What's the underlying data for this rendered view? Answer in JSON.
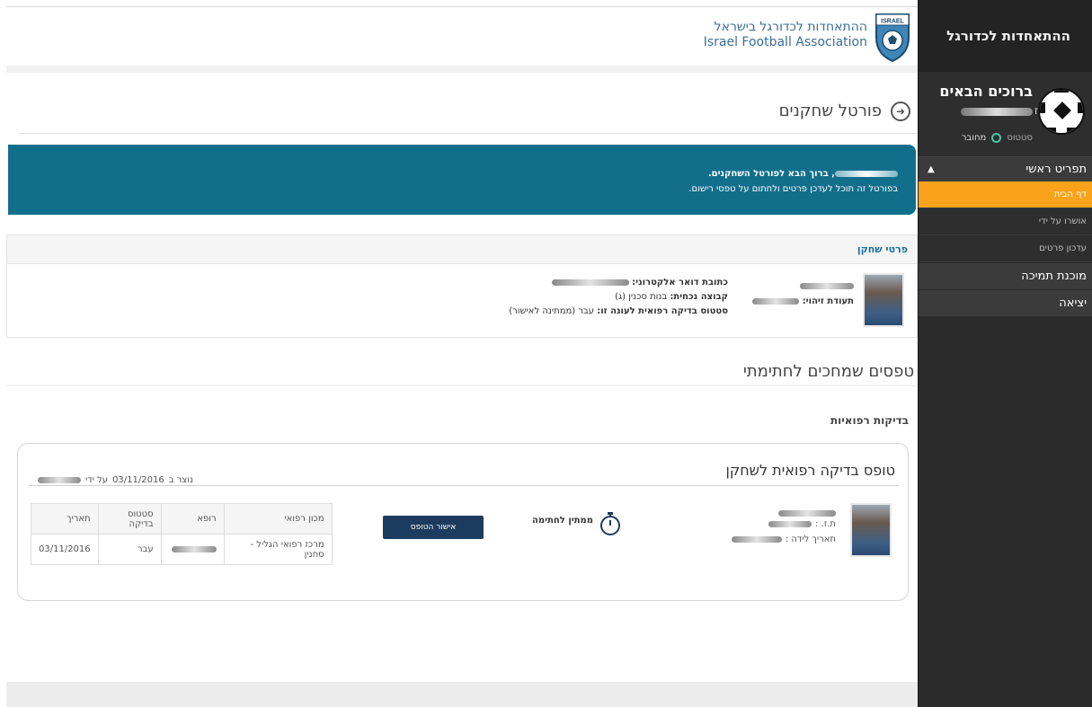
{
  "sidebar": {
    "brand": "ההתאחדות לכדורגל",
    "user_greeting": "ברוכים הבאים",
    "user_id_suffix": "ז",
    "status_label": "סטטוס",
    "status_value": "מחובר",
    "status_color": "#4bc6a4",
    "main_menu_label": "תפריט ראשי",
    "main_menu_icon": "triangle-up-icon",
    "sub_items": [
      {
        "label": "דף הבית",
        "active": true
      },
      {
        "label": "אושרו על ידי"
      },
      {
        "label": "עדכון פרטים"
      }
    ],
    "support_label": "מוכנת תמיכה",
    "logout_label": "יציאה"
  },
  "header": {
    "org_he": "ההתאחדות לכדורגל בישראל",
    "org_en": "Israel Football Association",
    "badge_text": "ISRAEL",
    "brand_color": "#3a6d96"
  },
  "portal": {
    "title": "פורטל שחקנים",
    "welcome_line1_suffix": ", ברוך הבא לפורטל השחקנים.",
    "welcome_line2": "בפורטל זה תוכל לעדכן פרטים ולחתום על טפסי רישום.",
    "banner_color": "#126f8c"
  },
  "player_details": {
    "heading": "פרטי שחקן",
    "id_label": "תעודת זיהוי:",
    "email_label": "כתובת דואר אלקטרוני:",
    "group_label": "קבוצה נכחית:",
    "group_value": "בנות סכנין (ג)",
    "medical_status_label": "סטטוס בדיקה רפואית לעונה זו:",
    "medical_status_value": "עבר (ממתינה לאישור)"
  },
  "forms": {
    "title": "טפסים שמחכים לחתימתי",
    "category": "בדיקות רפואיות",
    "card": {
      "title": "טופס בדיקה רפואית לשחקן",
      "created_prefix": "נוצר ב",
      "created_date": "03/11/2016",
      "created_by": "על ידי",
      "id_label": "ת.ז. :",
      "dob_label": "תאריך לידה :",
      "waiting_label": "ממתין לחתימה",
      "approve_button": "אישור הטופס",
      "table_headers": [
        "מכון רפואי",
        "רופא",
        "סטטוס בדיקה",
        "תאריך"
      ],
      "table_row": {
        "center": "מרכז רפואי הגליל - סחנין",
        "status": "עבר",
        "date": "03/11/2016"
      }
    }
  }
}
